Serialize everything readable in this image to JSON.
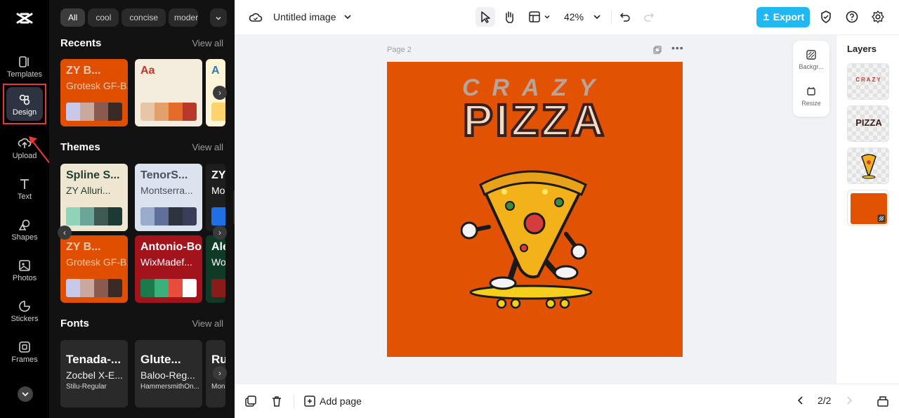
{
  "rail": {
    "items": [
      {
        "label": "Templates"
      },
      {
        "label": "Design"
      },
      {
        "label": "Upload"
      },
      {
        "label": "Text"
      },
      {
        "label": "Shapes"
      },
      {
        "label": "Photos"
      },
      {
        "label": "Stickers"
      },
      {
        "label": "Frames"
      }
    ]
  },
  "panel": {
    "chips": [
      "All",
      "cool",
      "concise",
      "modern"
    ],
    "recents": {
      "title": "Recents",
      "view_all": "View all",
      "cards": [
        {
          "t1": "ZY B...",
          "t2": "Grotesk GF-B...",
          "bg": "#e04e00",
          "fg": "#f0c9b0",
          "swatches": [
            "#c8c8ea",
            "#c9a8a0",
            "#8a5a4e",
            "#3a2a26"
          ]
        },
        {
          "t1": "Aa",
          "t2": "",
          "bg": "#f4ecdc",
          "fg": "#c0392b",
          "swatches": [
            "#e6c6a6",
            "#e3a06a",
            "#e56b2a",
            "#b8382a"
          ]
        },
        {
          "t1": "A",
          "t2": "",
          "bg": "#fff4d6",
          "fg": "#2b7bb9",
          "swatches": [
            "#ffd36b",
            "#f5b740"
          ]
        }
      ]
    },
    "themes": {
      "title": "Themes",
      "view_all": "View all",
      "cards": [
        {
          "t1": "Spline S...",
          "t2": "ZY Alluri...",
          "bg": "#efe6d2",
          "fg": "#1f3f33",
          "swatches": [
            "#8fd4b8",
            "#6ba598",
            "#3e5a52",
            "#1b3a34"
          ]
        },
        {
          "t1": "TenorS...",
          "t2": "Montserra...",
          "bg": "#dbe4ee",
          "fg": "#4a5060",
          "swatches": [
            "#9aaccc",
            "#60709a",
            "#2d3440",
            "#3a3e58"
          ]
        },
        {
          "t1": "ZY",
          "t2": "Mo",
          "bg": "#1e1e1e",
          "fg": "#ffffff",
          "swatches": [
            "#1f6fe6"
          ]
        },
        {
          "t1": "ZY B...",
          "t2": "Grotesk GF-B...",
          "bg": "#e04e00",
          "fg": "#f0c9b0",
          "swatches": [
            "#c8c8ea",
            "#c9a8a0",
            "#8a5a4e",
            "#3a2a26"
          ]
        },
        {
          "t1": "Antonio-Bold",
          "t2": "WixMadef...",
          "bg": "#a3131b",
          "fg": "#ffffff",
          "swatches": [
            "#1b7a4a",
            "#3bb07a",
            "#e74c3c",
            "#ffffff"
          ]
        },
        {
          "t1": "Ale",
          "t2": "Wo",
          "bg": "#0f3a26",
          "fg": "#ffffff",
          "swatches": [
            "#8b1a1a"
          ]
        }
      ]
    },
    "fonts": {
      "title": "Fonts",
      "view_all": "View all",
      "cards": [
        {
          "f1": "Tenada-...",
          "f2": "Zocbel X-E...",
          "f3": "Stilu-Regular"
        },
        {
          "f1": "Glute...",
          "f2": "Baloo-Reg...",
          "f3": "HammersmithOn..."
        },
        {
          "f1": "Ru",
          "f2": "",
          "f3": "Mon"
        }
      ]
    }
  },
  "topbar": {
    "title": "Untitled image",
    "zoom": "42%",
    "export_label": "Export"
  },
  "canvas": {
    "page_label": "Page 2",
    "art_title_small": "CRAZY",
    "art_title_big": "PIZZA",
    "side_tools": [
      {
        "label": "Backgr..."
      },
      {
        "label": "Resize"
      }
    ]
  },
  "layers": {
    "title": "Layers",
    "items": [
      {
        "text": "CRAZY",
        "color": "#c0392b"
      },
      {
        "text": "PIZZA",
        "color": "#3a1f1a"
      },
      {
        "text": "",
        "color": ""
      },
      {
        "text": "",
        "color": "#e15203"
      }
    ]
  },
  "bottombar": {
    "add_page_label": "Add page",
    "page_count": "2/2"
  },
  "colors": {
    "accent": "#1fb8f3",
    "artboard": "#e15203",
    "highlight": "#e53935"
  }
}
